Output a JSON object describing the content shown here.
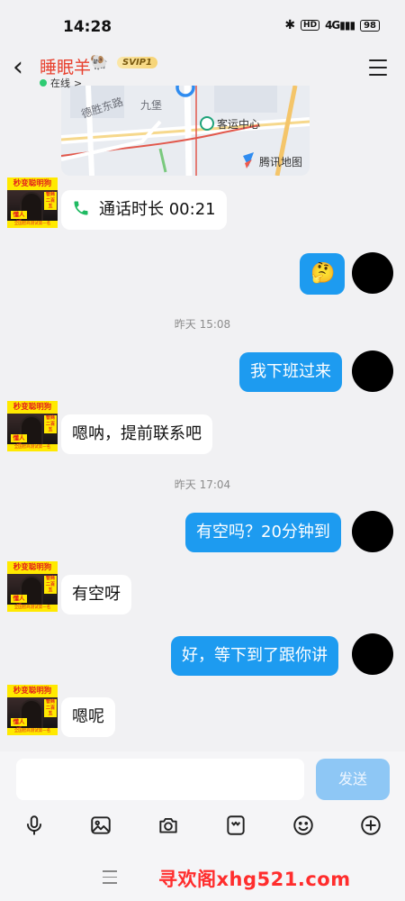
{
  "status_bar": {
    "time": "14:28",
    "hd": "HD",
    "network": "4G",
    "battery": "98"
  },
  "header": {
    "contact_name": "睡眠羊",
    "sheep_emoji": "🐏",
    "vip_badge": "SVIP1",
    "status": "在线",
    "status_arrow": ">"
  },
  "map_card": {
    "road_1": "德胜东路",
    "road_2": "九堡",
    "poi": "客运中心",
    "brand": "腾讯地图"
  },
  "avatar_text": {
    "top": "秒变聪明狗",
    "sticker": "懂人话",
    "side": "智商二百五",
    "foot": "全国智商测试第一名"
  },
  "messages": [
    {
      "side": "left",
      "icon": "phone-icon",
      "text": "通话时长 00:21"
    },
    {
      "side": "right",
      "icon": "emoji-face-icon",
      "emoji": "🤔"
    },
    {
      "side": "time",
      "text": "昨天 15:08"
    },
    {
      "side": "right",
      "text": "我下班过来"
    },
    {
      "side": "left",
      "text": "嗯呐，提前联系吧"
    },
    {
      "side": "time",
      "text": "昨天 17:04"
    },
    {
      "side": "right",
      "text": "有空吗？20分钟到"
    },
    {
      "side": "left",
      "text": "有空呀"
    },
    {
      "side": "right",
      "text": "好，等下到了跟你讲"
    },
    {
      "side": "left",
      "text": "嗯呢"
    }
  ],
  "input_bar": {
    "send_label": "发送"
  },
  "toolbar": {
    "icons": [
      "microphone-icon",
      "image-icon",
      "camera-icon",
      "sticker-icon",
      "emoji-icon",
      "plus-icon"
    ]
  },
  "watermark": {
    "text": "寻欢阁xhg521.com"
  },
  "colors": {
    "bubble_self": "#1d9bf0",
    "contact_name": "#e8412f",
    "online_dot": "#2ecb72",
    "send_disabled": "#8ec7f5"
  }
}
